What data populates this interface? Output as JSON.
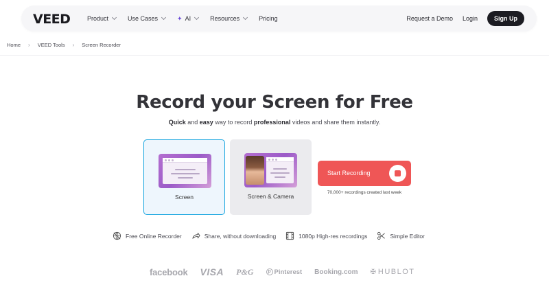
{
  "nav": {
    "logo": "VEED",
    "items": [
      {
        "label": "Product",
        "has_dropdown": true
      },
      {
        "label": "Use Cases",
        "has_dropdown": true
      },
      {
        "label": "AI",
        "has_dropdown": true,
        "icon": "sparkle-icon"
      },
      {
        "label": "Resources",
        "has_dropdown": true
      },
      {
        "label": "Pricing",
        "has_dropdown": false
      }
    ],
    "request_demo": "Request a Demo",
    "login": "Login",
    "signup": "Sign Up"
  },
  "breadcrumb": [
    "Home",
    "VEED Tools",
    "Screen Recorder"
  ],
  "hero": {
    "title": "Record your Screen for Free",
    "subtitle_parts": [
      "Quick",
      " and ",
      "easy",
      " way to record ",
      "professional",
      " videos and share them instantly."
    ]
  },
  "options": [
    {
      "label": "Screen",
      "selected": true
    },
    {
      "label": "Screen & Camera",
      "selected": false
    }
  ],
  "record": {
    "button": "Start Recording",
    "note": "70,000+ recordings created last week"
  },
  "features": [
    {
      "icon": "globe-off-icon",
      "label": "Free Online Recorder"
    },
    {
      "icon": "share-icon",
      "label": "Share, without downloading"
    },
    {
      "icon": "film-icon",
      "label": "1080p High-res recordings"
    },
    {
      "icon": "scissors-icon",
      "label": "Simple Editor"
    }
  ],
  "logos": [
    "facebook",
    "VISA",
    "P&G",
    "Pinterest",
    "Booking.com",
    "HUBLOT"
  ],
  "colors": {
    "accent_red": "#ef5656",
    "selected_border": "#1aa6e0",
    "dark": "#1c1c22"
  }
}
